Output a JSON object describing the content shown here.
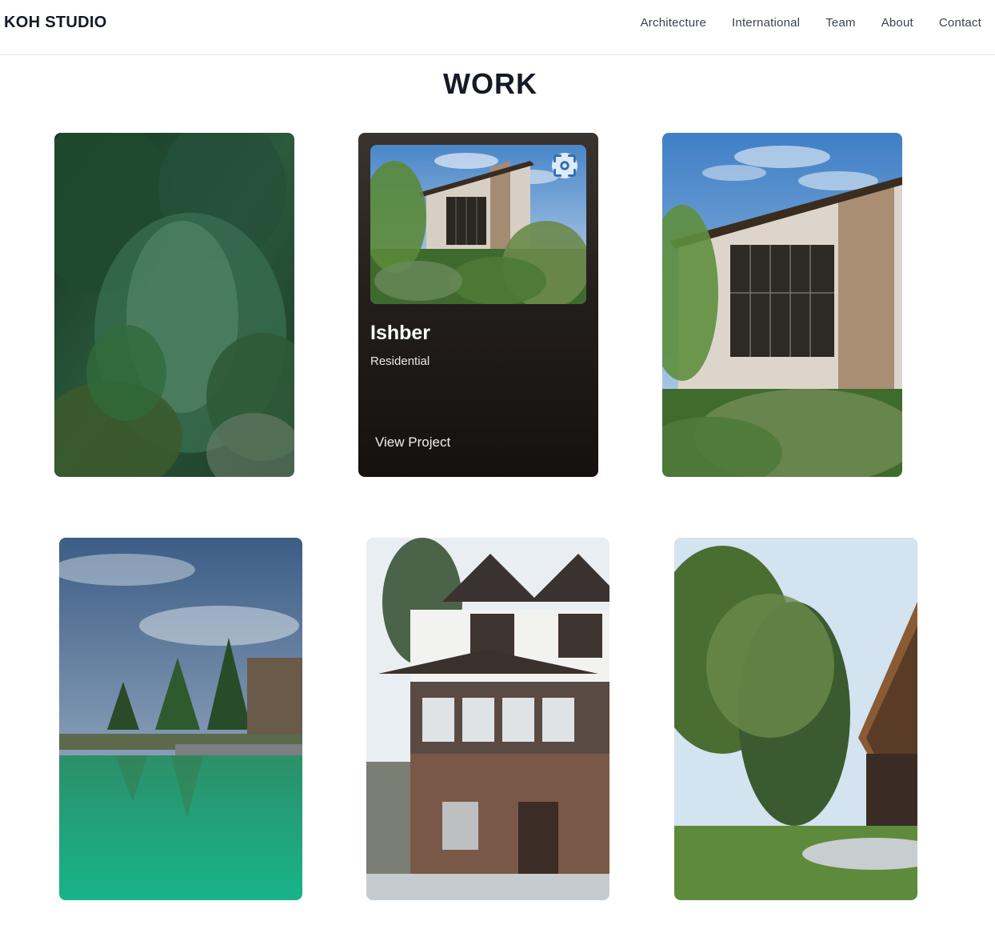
{
  "header": {
    "brand": "KOH STUDIO",
    "nav": [
      "Architecture",
      "International",
      "Team",
      "About",
      "Contact"
    ]
  },
  "main": {
    "title": "WORK",
    "featured": {
      "name": "Ishber",
      "category": "Residential",
      "link_label": "View Project",
      "icons": {
        "expand": "focus-scan-icon",
        "link": "arrow-right-icon"
      }
    },
    "projects": [
      {
        "image": "aerial-trees-render"
      },
      {
        "image": "modern-house-render"
      },
      {
        "image": "modern-house-angle-render"
      },
      {
        "image": "pool-lake-render"
      },
      {
        "image": "tudor-house-render"
      },
      {
        "image": "a-frame-cabin-render"
      }
    ]
  }
}
